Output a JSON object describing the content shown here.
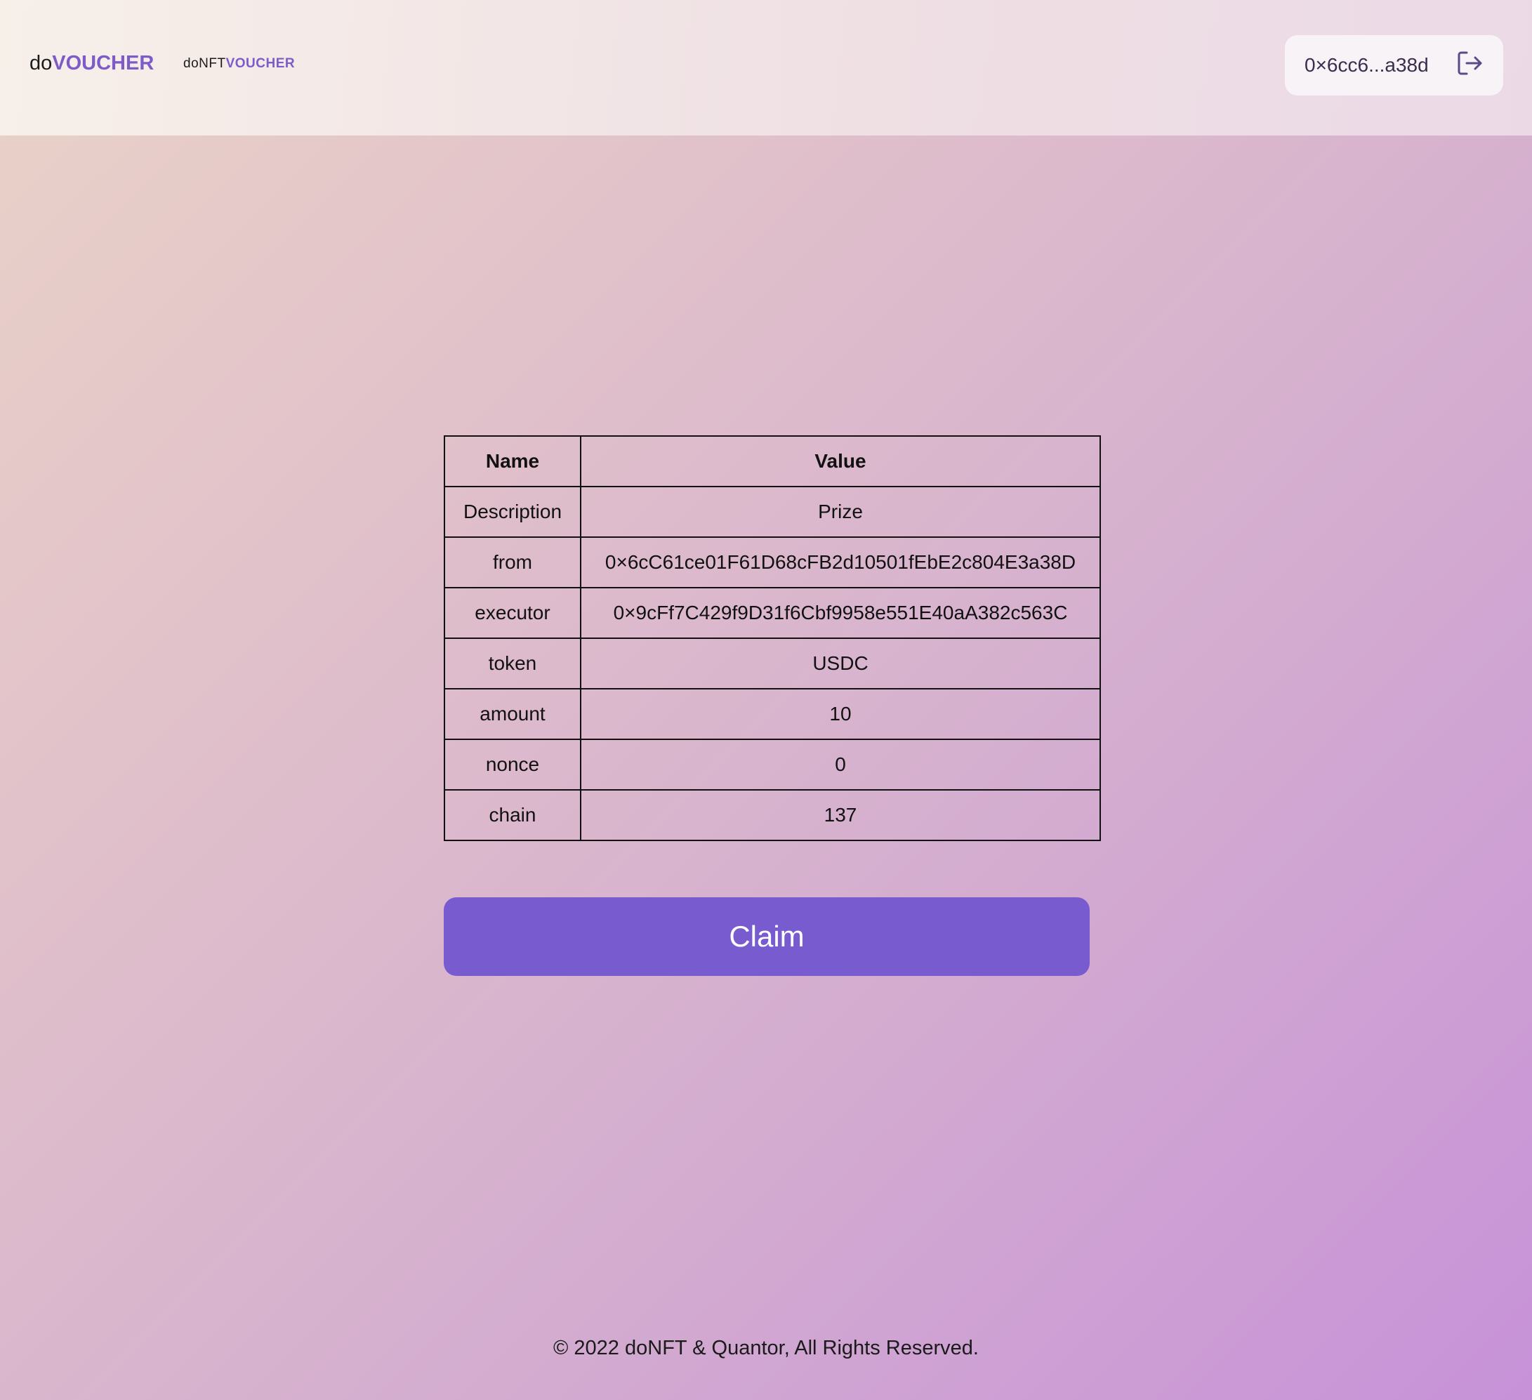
{
  "header": {
    "logo_main": {
      "prefix": "do",
      "highlight": "VOUCHER"
    },
    "logo_sub": {
      "prefix": "doNFT",
      "highlight": "VOUCHER"
    },
    "wallet": {
      "address": "0×6cc6...a38d",
      "logout_icon": "logout-icon"
    }
  },
  "table": {
    "headers": {
      "name": "Name",
      "value": "Value"
    },
    "rows": [
      {
        "name": "Description",
        "value": "Prize"
      },
      {
        "name": "from",
        "value": "0×6cC61ce01F61D68cFB2d10501fEbE2c804E3a38D"
      },
      {
        "name": "executor",
        "value": "0×9cFf7C429f9D31f6Cbf9958e551E40aA382c563C"
      },
      {
        "name": "token",
        "value": "USDC"
      },
      {
        "name": "amount",
        "value": "10"
      },
      {
        "name": "nonce",
        "value": "0"
      },
      {
        "name": "chain",
        "value": "137"
      }
    ]
  },
  "claim_button": {
    "label": "Claim"
  },
  "footer": {
    "text": "© 2022 doNFT & Quantor, All Rights Reserved."
  },
  "colors": {
    "accent": "#785ccf",
    "brand_purple": "#7d5bc9",
    "text": "#111111"
  }
}
